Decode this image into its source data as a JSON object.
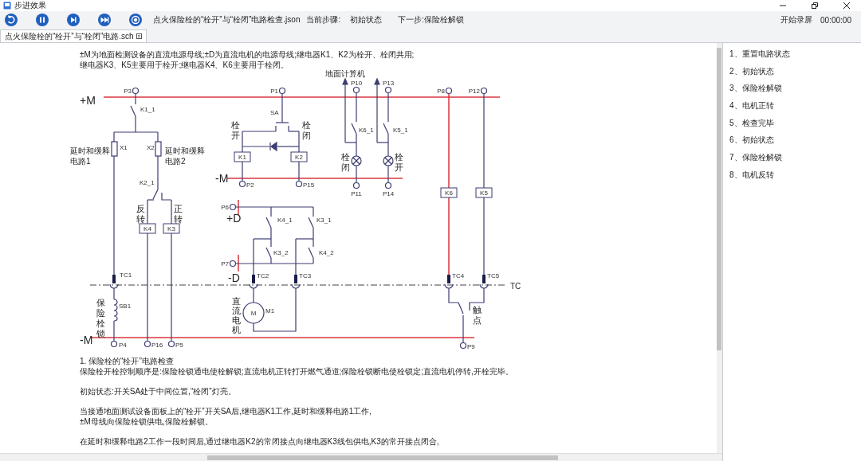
{
  "window": {
    "title": "步进效果"
  },
  "toolbar": {
    "file": "点火保险栓的“栓开”与“栓闭”电路检查.json",
    "step_label": "当前步骤:",
    "step": "初始状态",
    "next_step": "下一步:保险栓解锁",
    "record": "开始录屏",
    "timer": "00:00:00"
  },
  "tabs": [
    {
      "label": "点火保险栓的“栓开”与“栓闭”电路.sch",
      "selected": true
    }
  ],
  "document": {
    "intro": [
      "±M为地面检测设备的直流电源母线;±D为直流电机的电源母线;继电器K1、K2为栓开、栓闭共用;",
      "继电器K3、K5主要用于栓开;继电器K4、K6主要用于栓闭。"
    ],
    "labels": [
      {
        "text": "+M",
        "kind": "bus"
      },
      {
        "text": "P3",
        "kind": "pin"
      },
      {
        "text": "K1_1",
        "kind": "pin"
      },
      {
        "text": "延时和缓释",
        "kind": "note"
      },
      {
        "text": "电路1",
        "kind": "note"
      },
      {
        "text": "X1",
        "kind": "pin"
      },
      {
        "text": "X2",
        "kind": "pin"
      },
      {
        "text": "延时和缓释",
        "kind": "note"
      },
      {
        "text": "电路2",
        "kind": "note"
      },
      {
        "text": "K2_1",
        "kind": "pin"
      },
      {
        "text": "反转",
        "kind": "vertical"
      },
      {
        "text": "正转",
        "kind": "vertical"
      },
      {
        "text": "K4",
        "kind": "relay"
      },
      {
        "text": "K3",
        "kind": "relay"
      },
      {
        "text": "TC1",
        "kind": "pin"
      },
      {
        "text": "SB1",
        "kind": "pin"
      },
      {
        "text": "保险栓锁",
        "kind": "vertical"
      },
      {
        "text": "-M",
        "kind": "bus"
      },
      {
        "text": "P4",
        "kind": "pin"
      },
      {
        "text": "P16",
        "kind": "pin"
      },
      {
        "text": "P5",
        "kind": "pin"
      },
      {
        "text": "P1",
        "kind": "pin"
      },
      {
        "text": "SA",
        "kind": "pin"
      },
      {
        "text": "栓开",
        "kind": "vertical"
      },
      {
        "text": "栓闭",
        "kind": "vertical"
      },
      {
        "text": "K1",
        "kind": "relay"
      },
      {
        "text": "K2",
        "kind": "relay"
      },
      {
        "text": "-M",
        "kind": "bus"
      },
      {
        "text": "P2",
        "kind": "pin"
      },
      {
        "text": "P15",
        "kind": "pin"
      },
      {
        "text": "地面计算机",
        "kind": "note"
      },
      {
        "text": "P10",
        "kind": "pin"
      },
      {
        "text": "P13",
        "kind": "pin"
      },
      {
        "text": "K6_1",
        "kind": "pin"
      },
      {
        "text": "K5_1",
        "kind": "pin"
      },
      {
        "text": "栓闭",
        "kind": "vertical"
      },
      {
        "text": "栓开",
        "kind": "vertical"
      },
      {
        "text": "P11",
        "kind": "pin"
      },
      {
        "text": "P14",
        "kind": "pin"
      },
      {
        "text": "P8",
        "kind": "pin"
      },
      {
        "text": "P12",
        "kind": "pin"
      },
      {
        "text": "K6",
        "kind": "relay"
      },
      {
        "text": "K5",
        "kind": "relay"
      },
      {
        "text": "P6",
        "kind": "pin"
      },
      {
        "text": "+D",
        "kind": "bus"
      },
      {
        "text": "K4_1",
        "kind": "pin"
      },
      {
        "text": "K3_1",
        "kind": "pin"
      },
      {
        "text": "K3_2",
        "kind": "pin"
      },
      {
        "text": "K4_2",
        "kind": "pin"
      },
      {
        "text": "P7",
        "kind": "pin"
      },
      {
        "text": "-D",
        "kind": "bus"
      },
      {
        "text": "TC2",
        "kind": "pin"
      },
      {
        "text": "TC3",
        "kind": "pin"
      },
      {
        "text": "TC4",
        "kind": "pin"
      },
      {
        "text": "TC5",
        "kind": "pin"
      },
      {
        "text": "TC",
        "kind": "note"
      },
      {
        "text": "M",
        "kind": "pin"
      },
      {
        "text": "M1",
        "kind": "pin"
      },
      {
        "text": "直流电机",
        "kind": "vertical"
      },
      {
        "text": "触点",
        "kind": "vertical"
      },
      {
        "text": "P9",
        "kind": "pin"
      }
    ],
    "notes": [
      {
        "lines": [
          "1. 保险栓的“栓开”电路检查",
          "保险栓开栓控制顺序是:保险栓锁通电使栓解锁;直流电机正转打开燃气通道;保险栓锁断电使栓锁定;直流电机停转,开栓完毕。"
        ]
      },
      {
        "lines": [
          "初始状态:开关SA处于中间位置,“栓闭”灯亮。"
        ]
      },
      {
        "lines": [
          "当接通地面测试设备面板上的“栓开”开关SA后,继电器K1工作,延时和缓释电路1工作,",
          "±M母线向保险栓锁供电,保险栓解锁。"
        ]
      },
      {
        "lines": [
          "在延时和缓释电路2工作一段时间后,通过继电器K2的常闭接点向继电器K3线包供电,K3的常开接点闭合,"
        ]
      }
    ]
  },
  "steps": [
    {
      "label": "1、重置电路状态",
      "selected": false
    },
    {
      "label": "2、初始状态",
      "selected": false
    },
    {
      "label": "3、保险栓解锁",
      "selected": false
    },
    {
      "label": "4、电机正转",
      "selected": false
    },
    {
      "label": "5、检查完毕",
      "selected": false
    },
    {
      "label": "6、初始状态",
      "selected": false
    },
    {
      "label": "7、保险栓解锁",
      "selected": false
    },
    {
      "label": "8、电机反转",
      "selected": false
    }
  ]
}
